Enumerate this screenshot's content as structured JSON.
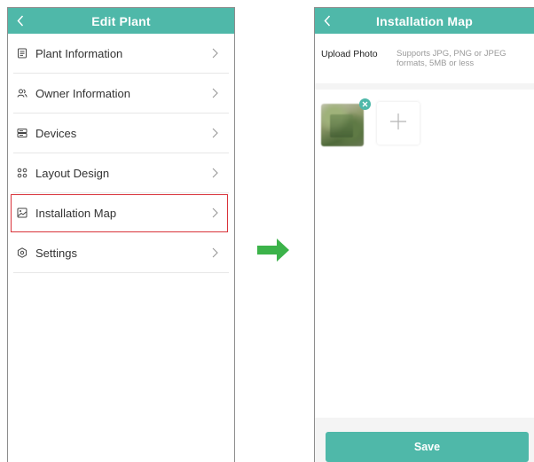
{
  "left_screen": {
    "title": "Edit Plant",
    "back_icon": "chevron-left-icon",
    "items": [
      {
        "label": "Plant Information",
        "icon": "document-icon"
      },
      {
        "label": "Owner Information",
        "icon": "users-icon"
      },
      {
        "label": "Devices",
        "icon": "server-icon"
      },
      {
        "label": "Layout Design",
        "icon": "layout-icon"
      },
      {
        "label": "Installation Map",
        "icon": "image-icon",
        "highlighted": true
      },
      {
        "label": "Settings",
        "icon": "settings-icon"
      }
    ]
  },
  "transition_arrow": {
    "icon": "arrow-right-icon",
    "color": "#3cb34a"
  },
  "right_screen": {
    "title": "Installation Map",
    "back_icon": "chevron-left-icon",
    "upload_label": "Upload Photo",
    "upload_hint": "Supports JPG, PNG or JPEG formats, 5MB or less",
    "photo_count": 1,
    "save_label": "Save"
  },
  "colors": {
    "header": "#4fb8a9",
    "highlight_border": "#d9333a",
    "arrow": "#3cb34a"
  }
}
